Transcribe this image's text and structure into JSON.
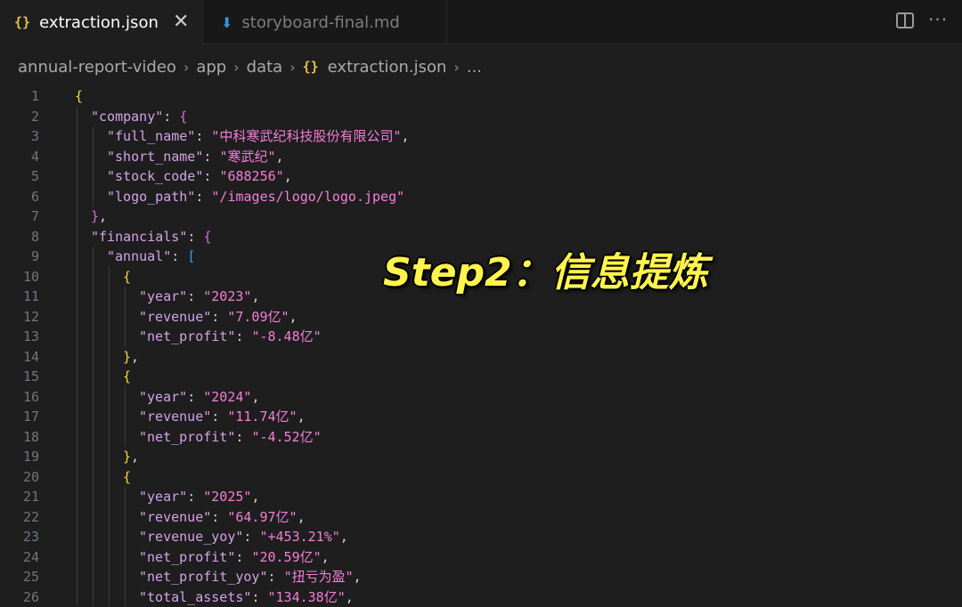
{
  "tabs": [
    {
      "icon": "json-file-icon",
      "icon_glyph": "{}",
      "label": "extraction.json",
      "active": true
    },
    {
      "icon": "markdown-file-icon",
      "icon_glyph": "⬇",
      "label": "storyboard-final.md",
      "active": false
    }
  ],
  "tab_close_glyph": "✕",
  "more_actions_glyph": "···",
  "breadcrumb": {
    "items": [
      "annual-report-video",
      "app",
      "data",
      "extraction.json",
      "..."
    ],
    "separator": "›",
    "file_icon_glyph": "{}"
  },
  "overlay_text": "Step2：信息提炼",
  "colors": {
    "background": "#1e1e1e",
    "key": "#d6a2ea",
    "string": "#f47fd8",
    "bracket_level1": "#f8d44a",
    "bracket_level2": "#d66be0",
    "bracket_level3": "#3c9df0",
    "overlay": "#fff44d"
  },
  "code": {
    "line_numbers": [
      "1",
      "2",
      "3",
      "4",
      "5",
      "6",
      "7",
      "8",
      "9",
      "10",
      "11",
      "12",
      "13",
      "14",
      "15",
      "16",
      "17",
      "18",
      "19",
      "20",
      "21",
      "22",
      "23",
      "24",
      "25",
      "26"
    ],
    "lines": [
      [
        {
          "t": "{",
          "c": "b1"
        }
      ],
      [
        {
          "t": "\"company\"",
          "c": "k"
        },
        {
          "t": ": ",
          "c": "p"
        },
        {
          "t": "{",
          "c": "b2"
        }
      ],
      [
        {
          "t": "\"full_name\"",
          "c": "k"
        },
        {
          "t": ": ",
          "c": "p"
        },
        {
          "t": "\"中科寒武纪科技股份有限公司\"",
          "c": "s"
        },
        {
          "t": ",",
          "c": "p"
        }
      ],
      [
        {
          "t": "\"short_name\"",
          "c": "k"
        },
        {
          "t": ": ",
          "c": "p"
        },
        {
          "t": "\"寒武纪\"",
          "c": "s"
        },
        {
          "t": ",",
          "c": "p"
        }
      ],
      [
        {
          "t": "\"stock_code\"",
          "c": "k"
        },
        {
          "t": ": ",
          "c": "p"
        },
        {
          "t": "\"688256\"",
          "c": "s"
        },
        {
          "t": ",",
          "c": "p"
        }
      ],
      [
        {
          "t": "\"logo_path\"",
          "c": "k"
        },
        {
          "t": ": ",
          "c": "p"
        },
        {
          "t": "\"/images/logo/logo.jpeg\"",
          "c": "s"
        }
      ],
      [
        {
          "t": "}",
          "c": "b2"
        },
        {
          "t": ",",
          "c": "p"
        }
      ],
      [
        {
          "t": "\"financials\"",
          "c": "k"
        },
        {
          "t": ": ",
          "c": "p"
        },
        {
          "t": "{",
          "c": "b2"
        }
      ],
      [
        {
          "t": "\"annual\"",
          "c": "k"
        },
        {
          "t": ": ",
          "c": "p"
        },
        {
          "t": "[",
          "c": "b3"
        }
      ],
      [
        {
          "t": "{",
          "c": "b1"
        }
      ],
      [
        {
          "t": "\"year\"",
          "c": "k"
        },
        {
          "t": ": ",
          "c": "p"
        },
        {
          "t": "\"2023\"",
          "c": "s"
        },
        {
          "t": ",",
          "c": "p"
        }
      ],
      [
        {
          "t": "\"revenue\"",
          "c": "k"
        },
        {
          "t": ": ",
          "c": "p"
        },
        {
          "t": "\"7.09亿\"",
          "c": "s"
        },
        {
          "t": ",",
          "c": "p"
        }
      ],
      [
        {
          "t": "\"net_profit\"",
          "c": "k"
        },
        {
          "t": ": ",
          "c": "p"
        },
        {
          "t": "\"-8.48亿\"",
          "c": "s"
        }
      ],
      [
        {
          "t": "}",
          "c": "b1"
        },
        {
          "t": ",",
          "c": "p"
        }
      ],
      [
        {
          "t": "{",
          "c": "b1"
        }
      ],
      [
        {
          "t": "\"year\"",
          "c": "k"
        },
        {
          "t": ": ",
          "c": "p"
        },
        {
          "t": "\"2024\"",
          "c": "s"
        },
        {
          "t": ",",
          "c": "p"
        }
      ],
      [
        {
          "t": "\"revenue\"",
          "c": "k"
        },
        {
          "t": ": ",
          "c": "p"
        },
        {
          "t": "\"11.74亿\"",
          "c": "s"
        },
        {
          "t": ",",
          "c": "p"
        }
      ],
      [
        {
          "t": "\"net_profit\"",
          "c": "k"
        },
        {
          "t": ": ",
          "c": "p"
        },
        {
          "t": "\"-4.52亿\"",
          "c": "s"
        }
      ],
      [
        {
          "t": "}",
          "c": "b1"
        },
        {
          "t": ",",
          "c": "p"
        }
      ],
      [
        {
          "t": "{",
          "c": "b1"
        }
      ],
      [
        {
          "t": "\"year\"",
          "c": "k"
        },
        {
          "t": ": ",
          "c": "p"
        },
        {
          "t": "\"2025\"",
          "c": "s"
        },
        {
          "t": ",",
          "c": "p"
        }
      ],
      [
        {
          "t": "\"revenue\"",
          "c": "k"
        },
        {
          "t": ": ",
          "c": "p"
        },
        {
          "t": "\"64.97亿\"",
          "c": "s"
        },
        {
          "t": ",",
          "c": "p"
        }
      ],
      [
        {
          "t": "\"revenue_yoy\"",
          "c": "k"
        },
        {
          "t": ": ",
          "c": "p"
        },
        {
          "t": "\"+453.21%\"",
          "c": "s"
        },
        {
          "t": ",",
          "c": "p"
        }
      ],
      [
        {
          "t": "\"net_profit\"",
          "c": "k"
        },
        {
          "t": ": ",
          "c": "p"
        },
        {
          "t": "\"20.59亿\"",
          "c": "s"
        },
        {
          "t": ",",
          "c": "p"
        }
      ],
      [
        {
          "t": "\"net_profit_yoy\"",
          "c": "k"
        },
        {
          "t": ": ",
          "c": "p"
        },
        {
          "t": "\"扭亏为盈\"",
          "c": "s"
        },
        {
          "t": ",",
          "c": "p"
        }
      ],
      [
        {
          "t": "\"total_assets\"",
          "c": "k"
        },
        {
          "t": ": ",
          "c": "p"
        },
        {
          "t": "\"134.38亿\"",
          "c": "s"
        },
        {
          "t": ",",
          "c": "p"
        }
      ]
    ]
  }
}
